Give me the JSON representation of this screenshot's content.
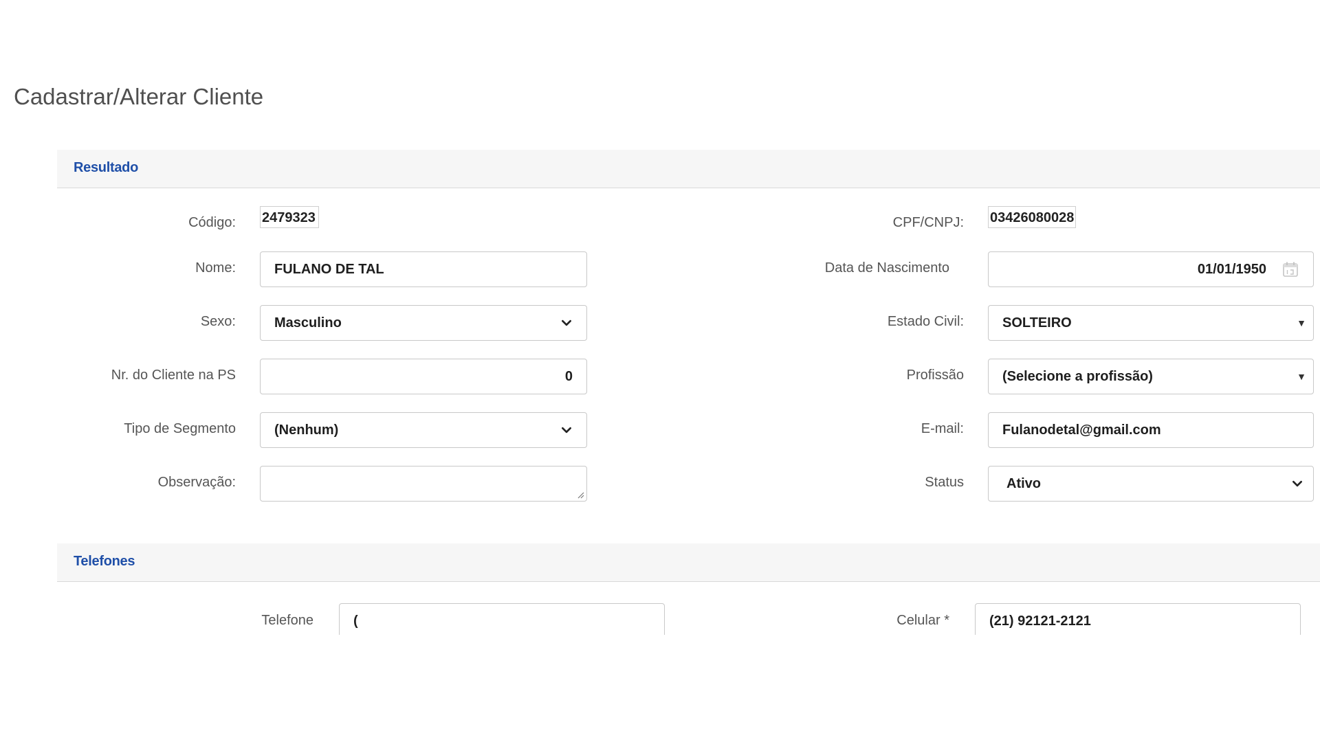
{
  "page": {
    "title": "Cadastrar/Alterar Cliente"
  },
  "sections": {
    "resultado": "Resultado",
    "telefones": "Telefones"
  },
  "form": {
    "codigo": {
      "label": "Código:",
      "value": "2479323"
    },
    "cpf": {
      "label": "CPF/CNPJ:",
      "value": "03426080028"
    },
    "nome": {
      "label": "Nome:",
      "value": "FULANO DE TAL"
    },
    "nascimento": {
      "label": "Data de Nascimento",
      "value": "01/01/1950"
    },
    "sexo": {
      "label": "Sexo:",
      "value": "Masculino"
    },
    "estado_civil": {
      "label": "Estado Civil:",
      "value": "SOLTEIRO"
    },
    "nr_cliente": {
      "label": "Nr. do Cliente na PS",
      "value": "0"
    },
    "profissao": {
      "label": "Profissão",
      "value": "(Selecione a profissão)"
    },
    "segmento": {
      "label": "Tipo de Segmento",
      "value": "(Nenhum)"
    },
    "email": {
      "label": "E-mail:",
      "value": "Fulanodetal@gmail.com"
    },
    "observacao": {
      "label": "Observação:",
      "value": ""
    },
    "status": {
      "label": "Status",
      "value": "Ativo"
    }
  },
  "phones": {
    "telefone": {
      "label": "Telefone",
      "value": "("
    },
    "celular": {
      "label": "Celular *",
      "value": "(21) 92121-2121"
    }
  },
  "icons": {
    "dropdown": "chevron-down-icon",
    "dropdown_alt": "triangle-down-icon",
    "date": "calendar-icon"
  },
  "colors": {
    "accent": "#1f4fa8",
    "header_bg": "#f6f6f6",
    "border": "#c8c8c8"
  }
}
